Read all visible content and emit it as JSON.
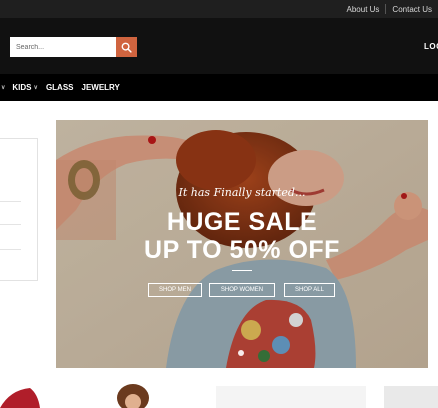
{
  "topbar": {
    "links": [
      "About Us",
      "Contact Us"
    ]
  },
  "header": {
    "search_placeholder": "Search...",
    "search_icon": "search-icon",
    "login_text": "LOG"
  },
  "nav": {
    "items": [
      {
        "label": "KIDS",
        "has_dropdown": true
      },
      {
        "label": "GLASS",
        "has_dropdown": false
      },
      {
        "label": "JEWELRY",
        "has_dropdown": false
      }
    ]
  },
  "banner": {
    "tagline": "It has Finally started...",
    "headline_1": "HUGE SALE",
    "headline_2": "UP TO 50% OFF",
    "buttons": [
      "SHOP MEN",
      "SHOP WOMEN",
      "SHOP ALL"
    ],
    "active_slide": 1
  },
  "colors": {
    "topbar": "#1f1f1f",
    "header": "#111111",
    "nav": "#000000",
    "accent": "#d0643f"
  }
}
